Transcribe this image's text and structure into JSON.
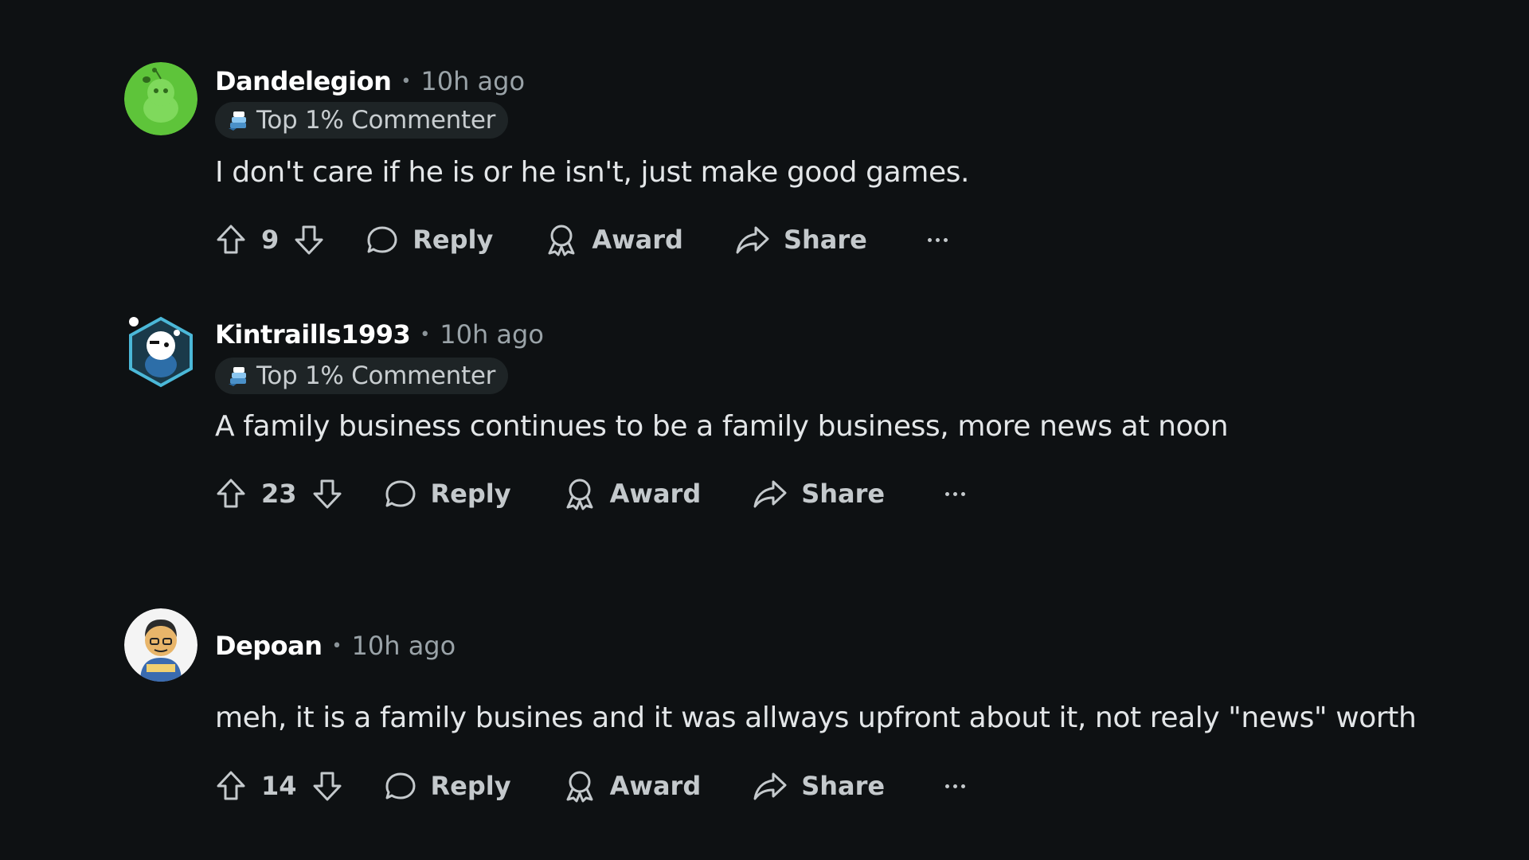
{
  "comments": [
    {
      "username": "Dandelegion",
      "separator": "•",
      "time": "10h ago",
      "flair": "Top 1% Commenter",
      "body": "I don't care if he is or he isn't, just make good games.",
      "votes": "9",
      "reply_label": "Reply",
      "award_label": "Award",
      "share_label": "Share"
    },
    {
      "username": "Kintraills1993",
      "separator": "•",
      "time": "10h ago",
      "flair": "Top 1% Commenter",
      "body": "A family business continues to be a family business, more news at noon",
      "votes": "23",
      "reply_label": "Reply",
      "award_label": "Award",
      "share_label": "Share"
    },
    {
      "username": "Depoan",
      "separator": "•",
      "time": "10h ago",
      "body": "meh, it is a family busines and it was allways upfront about it, not realy \"news\" worth",
      "votes": "14",
      "reply_label": "Reply",
      "award_label": "Award",
      "share_label": "Share"
    }
  ],
  "colors": {
    "background": "#0e1113",
    "username": "#ffffff",
    "meta": "#9aa3a8",
    "body_text": "#e3e6e8",
    "action_text": "#c4c9cc",
    "flair_bg": "#1e2426"
  },
  "icons": {
    "upvote": "arrow-up-outline-icon",
    "downvote": "arrow-down-outline-icon",
    "reply": "speech-bubble-icon",
    "award": "ribbon-award-icon",
    "share": "share-arrow-icon",
    "more": "ellipsis-icon",
    "flair": "top-commenter-icon"
  }
}
